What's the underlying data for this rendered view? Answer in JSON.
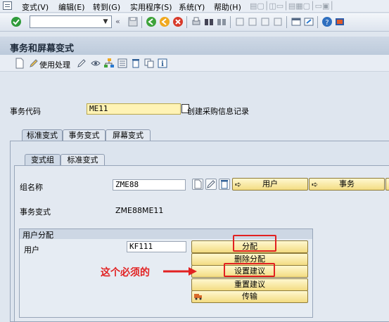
{
  "menubar": {
    "items": [
      {
        "label": "变式(V)"
      },
      {
        "label": "编辑(E)"
      },
      {
        "label": "转到(G)"
      },
      {
        "label": "实用程序(S)"
      },
      {
        "label": "系统(Y)"
      },
      {
        "label": "帮助(H)"
      }
    ]
  },
  "toolbar": {
    "command_value": ""
  },
  "page": {
    "title": "事务和屏幕变式"
  },
  "app_toolbar": {
    "use_handling_label": "使用处理"
  },
  "form": {
    "transaction_code_label": "事务代码",
    "transaction_code_value": "ME11",
    "transaction_description": "创建采购信息记录"
  },
  "main_tabs": [
    {
      "label": "标准变式"
    },
    {
      "label": "事务变式"
    },
    {
      "label": "屏幕变式"
    }
  ],
  "sub_tabs": [
    {
      "label": "变式组"
    },
    {
      "label": "标准变式"
    }
  ],
  "group": {
    "group_name_label": "组名称",
    "group_name_value": "ZME88",
    "user_button_label": "用户",
    "transaction_button_label": "事务",
    "transaction_variant_label": "事务变式",
    "transaction_variant_value": "ZME88ME11"
  },
  "user_assignment": {
    "section_title": "用户分配",
    "user_label": "用户",
    "user_value": "KF111",
    "buttons": {
      "assign": "分配",
      "delete_assign": "删除分配",
      "set_suggestion": "设置建议",
      "reset_suggestion": "重置建议",
      "transport": "传输"
    }
  },
  "annotation": {
    "text": "这个必须的"
  },
  "colors": {
    "annotation_red": "#e22121",
    "button_yellow": "#f3dc82",
    "highlight_field": "#fff3b5"
  }
}
